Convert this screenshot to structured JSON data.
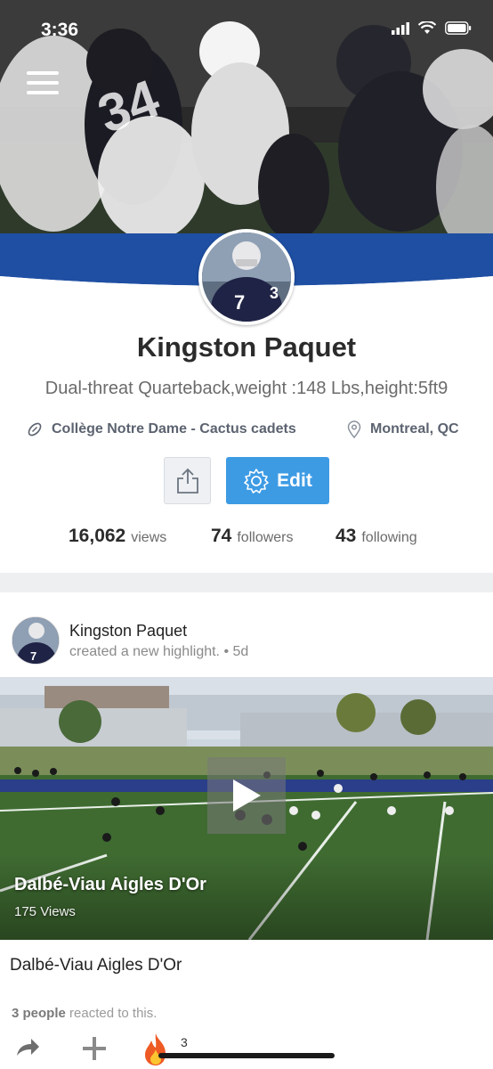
{
  "status_bar": {
    "time": "3:36"
  },
  "profile": {
    "name": "Kingston Paquet",
    "bio": "Dual-threat Quarteback,weight :148 Lbs,height:5ft9",
    "school": "Collège Notre Dame - Cactus cadets",
    "location": "Montreal, QC",
    "edit_label": "Edit",
    "stats": {
      "views_count": "16,062",
      "views_label": "views",
      "followers_count": "74",
      "followers_label": "followers",
      "following_count": "43",
      "following_label": "following"
    }
  },
  "post": {
    "author": "Kingston Paquet",
    "activity": "created a new highlight. • 5d",
    "video_title": "Dalbé-Viau Aigles D'Or",
    "video_views": "175 Views",
    "caption": "Dalbé-Viau Aigles D'Or",
    "reactions_count": "3 people",
    "reactions_text": "reacted to this.",
    "fire_count": "3"
  },
  "colors": {
    "brand_blue": "#1f4fa3",
    "edit_blue": "#3d9be4"
  },
  "icons": [
    "menu-icon",
    "signal-icon",
    "wifi-icon",
    "battery-icon",
    "football-icon",
    "location-pin-icon",
    "share-icon",
    "gear-icon",
    "play-icon",
    "forward-arrow-icon",
    "plus-icon",
    "fire-icon"
  ]
}
